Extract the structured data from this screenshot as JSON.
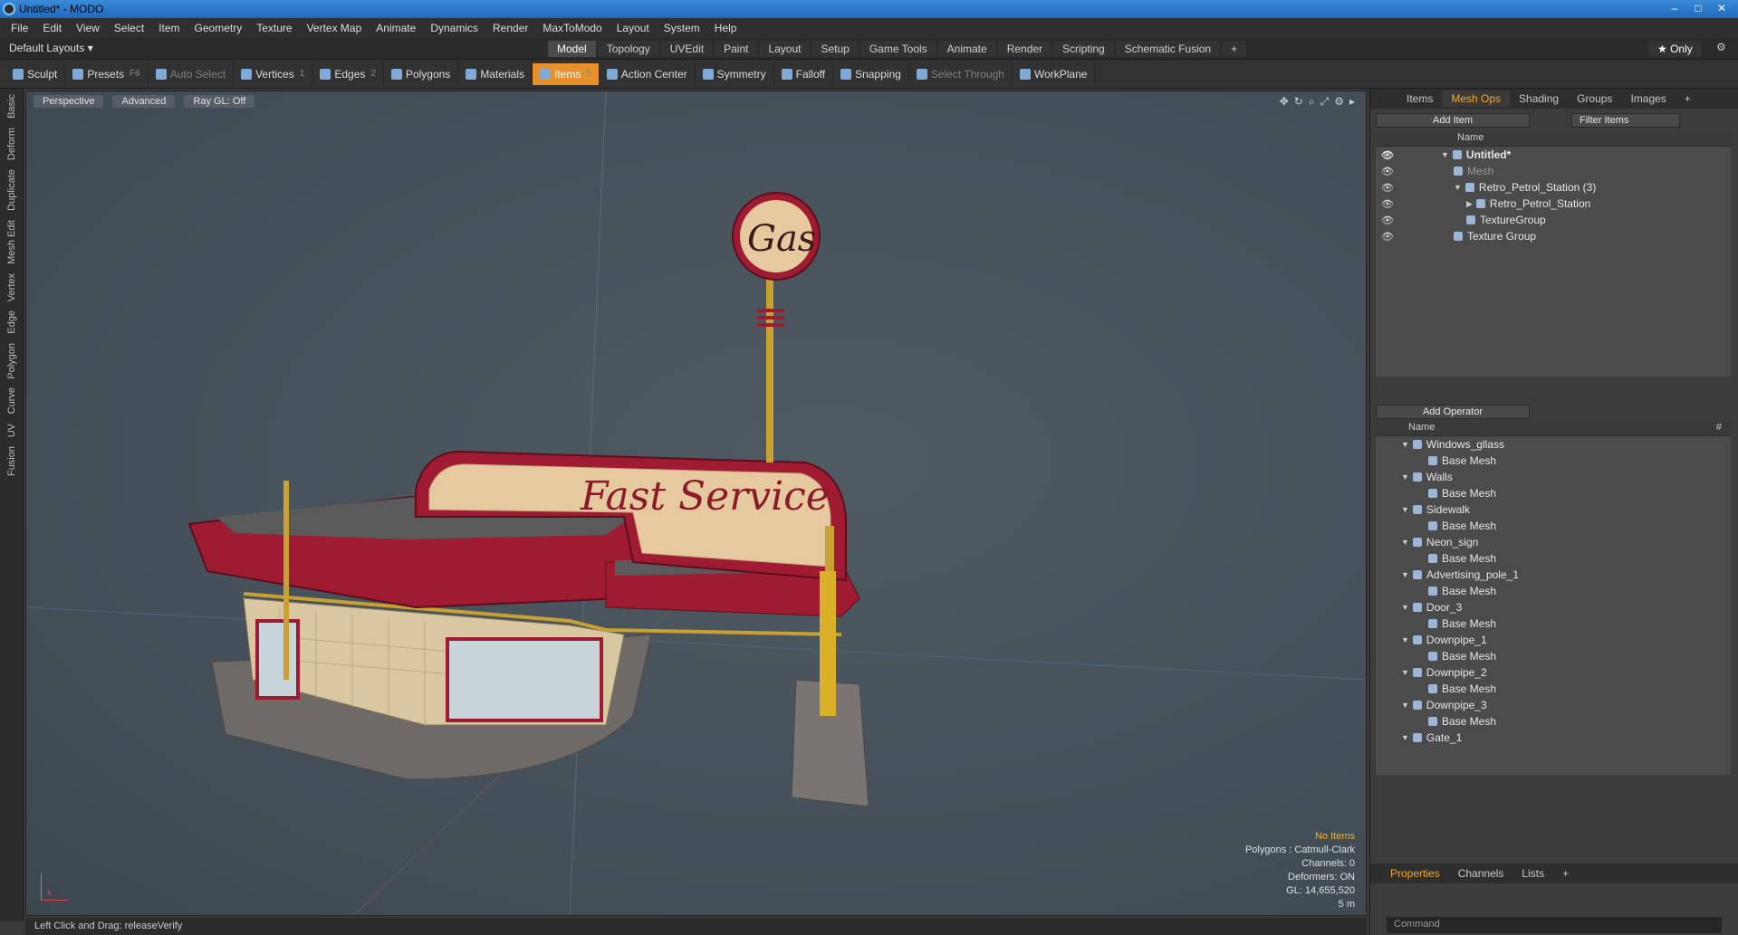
{
  "window": {
    "title": "Untitled* - MODO",
    "min": "–",
    "max": "□",
    "close": "✕"
  },
  "menu": [
    "File",
    "Edit",
    "View",
    "Select",
    "Item",
    "Geometry",
    "Texture",
    "Vertex Map",
    "Animate",
    "Dynamics",
    "Render",
    "MaxToModo",
    "Layout",
    "System",
    "Help"
  ],
  "layout": {
    "dropdown": "Default Layouts ▾",
    "tabs": [
      "Model",
      "Topology",
      "UVEdit",
      "Paint",
      "Layout",
      "Setup",
      "Game Tools",
      "Animate",
      "Render",
      "Scripting",
      "Schematic Fusion",
      "+"
    ],
    "active_tab": "Model",
    "only": "★ Only"
  },
  "toolbar": [
    {
      "label": "Sculpt",
      "key": "",
      "state": "normal"
    },
    {
      "label": "Presets",
      "key": "F6",
      "state": "normal"
    },
    {
      "label": "Auto Select",
      "key": "",
      "state": "dim"
    },
    {
      "label": "Vertices",
      "key": "1",
      "state": "normal"
    },
    {
      "label": "Edges",
      "key": "2",
      "state": "normal"
    },
    {
      "label": "Polygons",
      "key": "",
      "state": "normal"
    },
    {
      "label": "Materials",
      "key": "",
      "state": "normal"
    },
    {
      "label": "Items",
      "key": "5",
      "state": "on"
    },
    {
      "label": "Action Center",
      "key": "",
      "state": "normal"
    },
    {
      "label": "Symmetry",
      "key": "",
      "state": "normal"
    },
    {
      "label": "Falloff",
      "key": "",
      "state": "normal"
    },
    {
      "label": "Snapping",
      "key": "",
      "state": "normal"
    },
    {
      "label": "Select Through",
      "key": "",
      "state": "dim"
    },
    {
      "label": "WorkPlane",
      "key": "",
      "state": "normal"
    }
  ],
  "left_tabs": [
    "Basic",
    "Deform",
    "Duplicate",
    "Mesh Edit",
    "Vertex",
    "Edge",
    "Polygon",
    "Curve",
    "UV",
    "Fusion"
  ],
  "viewport": {
    "view": "Perspective",
    "mode": "Advanced",
    "raygl": "Ray GL: Off",
    "sign_gas": "Gas",
    "sign_fast": "Fast Service",
    "info": {
      "no_items": "No Items",
      "polygons": "Polygons : Catmull-Clark",
      "channels": "Channels: 0",
      "deformers": "Deformers: ON",
      "gl": "GL: 14,655,520",
      "scale": "5 m"
    },
    "axis_label": "x"
  },
  "status": "Left Click and Drag:  releaseVerify",
  "right": {
    "tabs": [
      "Items",
      "Mesh Ops",
      "Shading",
      "Groups",
      "Images",
      "+"
    ],
    "active_tab": "Mesh Ops",
    "add_item": "Add Item",
    "filter": "Filter Items",
    "col_name": "Name",
    "tree": [
      {
        "label": "Untitled*",
        "indent": 0,
        "bold": true,
        "dim": false,
        "tri": "▼"
      },
      {
        "label": "Mesh",
        "indent": 1,
        "bold": false,
        "dim": true,
        "tri": ""
      },
      {
        "label": "Retro_Petrol_Station (3)",
        "indent": 1,
        "bold": false,
        "dim": false,
        "tri": "▼"
      },
      {
        "label": "Retro_Petrol_Station",
        "indent": 2,
        "bold": false,
        "dim": false,
        "tri": "▶"
      },
      {
        "label": "TextureGroup",
        "indent": 2,
        "bold": false,
        "dim": false,
        "tri": ""
      },
      {
        "label": "Texture Group",
        "indent": 1,
        "bold": false,
        "dim": false,
        "tri": ""
      }
    ],
    "add_operator": "Add Operator",
    "ops_col": "Name",
    "ops_hash": "#",
    "ops": [
      {
        "label": "Windows_gllass",
        "child": "Base Mesh"
      },
      {
        "label": "Walls",
        "child": "Base Mesh"
      },
      {
        "label": "Sidewalk",
        "child": "Base Mesh"
      },
      {
        "label": "Neon_sign",
        "child": "Base Mesh"
      },
      {
        "label": "Advertising_pole_1",
        "child": "Base Mesh"
      },
      {
        "label": "Door_3",
        "child": "Base Mesh"
      },
      {
        "label": "Downpipe_1",
        "child": "Base Mesh"
      },
      {
        "label": "Downpipe_2",
        "child": "Base Mesh"
      },
      {
        "label": "Downpipe_3",
        "child": "Base Mesh"
      },
      {
        "label": "Gate_1",
        "child": ""
      }
    ],
    "bottom_tabs": [
      "Properties",
      "Channels",
      "Lists",
      "+"
    ],
    "bottom_active": "Properties",
    "command_placeholder": "Command"
  },
  "colors": {
    "accent": "#e8902a",
    "title_blue": "#1f6bbd",
    "sign_red": "#9e1b32",
    "sign_cream": "#e7c9a0"
  }
}
